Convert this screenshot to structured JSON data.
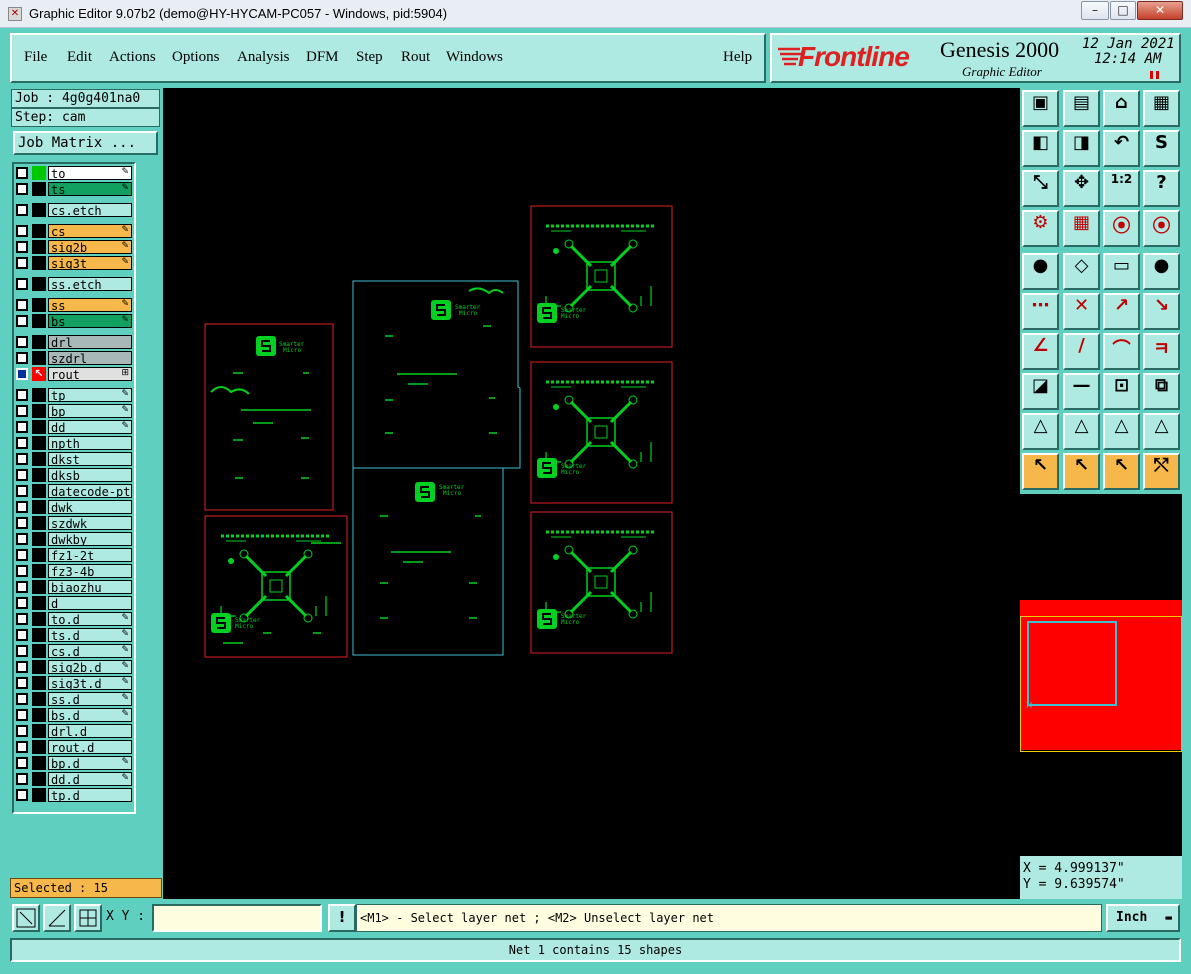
{
  "window": {
    "title": "Graphic Editor 9.07b2 (demo@HY-HYCAM-PC057 - Windows, pid:5904)",
    "minimize": "–",
    "maximize": "□",
    "close": "✕"
  },
  "menubar": {
    "items": [
      "File",
      "Edit",
      "Actions",
      "Options",
      "Analysis",
      "DFM",
      "Step",
      "Rout",
      "Windows"
    ],
    "help": "Help"
  },
  "brand": {
    "logo": "Frontline",
    "product": "Genesis 2000",
    "subtitle": "Graphic Editor",
    "date": "12 Jan 2021",
    "time": "12:14 AM"
  },
  "job": {
    "job_line": "Job : 4g0g401na0",
    "step_line": "Step: cam",
    "matrix_button": "Job Matrix ..."
  },
  "layers": [
    {
      "name": "to",
      "color": "#ffffff",
      "swatch": "#00c800",
      "edit": true
    },
    {
      "name": "ts",
      "color": "#12a060",
      "swatch": "#000000",
      "edit": true
    },
    {
      "name": "cs.etch",
      "color": "#aeeae2",
      "swatch": "#000000",
      "edit": false
    },
    {
      "name": "cs",
      "color": "#f6b84a",
      "swatch": "#000000",
      "edit": true
    },
    {
      "name": "sig2b",
      "color": "#f6b84a",
      "swatch": "#000000",
      "edit": true
    },
    {
      "name": "sig3t",
      "color": "#f6b84a",
      "swatch": "#000000",
      "edit": true
    },
    {
      "name": "ss.etch",
      "color": "#aeeae2",
      "swatch": "#000000",
      "edit": false
    },
    {
      "name": "ss",
      "color": "#f6b84a",
      "swatch": "#000000",
      "edit": true
    },
    {
      "name": "bs",
      "color": "#12a060",
      "swatch": "#000000",
      "edit": true
    },
    {
      "name": "drl",
      "color": "#a8b8b8",
      "swatch": "#000000",
      "edit": false
    },
    {
      "name": "szdrl",
      "color": "#a8b8b8",
      "swatch": "#000000",
      "edit": false
    },
    {
      "name": "rout",
      "color": "#e0e0e0",
      "swatch": "#ff0000",
      "edit": true,
      "active": true
    },
    {
      "name": "tp",
      "color": "#aeeae2",
      "swatch": "#000000",
      "edit": true
    },
    {
      "name": "bp",
      "color": "#aeeae2",
      "swatch": "#000000",
      "edit": true
    },
    {
      "name": "dd",
      "color": "#aeeae2",
      "swatch": "#000000",
      "edit": true
    },
    {
      "name": "npth",
      "color": "#aeeae2",
      "swatch": "#000000",
      "edit": false
    },
    {
      "name": "dkst",
      "color": "#aeeae2",
      "swatch": "#000000",
      "edit": false
    },
    {
      "name": "dksb",
      "color": "#aeeae2",
      "swatch": "#000000",
      "edit": false
    },
    {
      "name": "datecode-pte",
      "color": "#aeeae2",
      "swatch": "#000000",
      "edit": false
    },
    {
      "name": "dwk",
      "color": "#aeeae2",
      "swatch": "#000000",
      "edit": false
    },
    {
      "name": "szdwk",
      "color": "#aeeae2",
      "swatch": "#000000",
      "edit": false
    },
    {
      "name": "dwkby",
      "color": "#aeeae2",
      "swatch": "#000000",
      "edit": false
    },
    {
      "name": "fz1-2t",
      "color": "#aeeae2",
      "swatch": "#000000",
      "edit": false
    },
    {
      "name": "fz3-4b",
      "color": "#aeeae2",
      "swatch": "#000000",
      "edit": false
    },
    {
      "name": "biaozhu",
      "color": "#aeeae2",
      "swatch": "#000000",
      "edit": false
    },
    {
      "name": "d",
      "color": "#aeeae2",
      "swatch": "#000000",
      "edit": false
    },
    {
      "name": "to.d",
      "color": "#aeeae2",
      "swatch": "#000000",
      "edit": true
    },
    {
      "name": "ts.d",
      "color": "#aeeae2",
      "swatch": "#000000",
      "edit": true
    },
    {
      "name": "cs.d",
      "color": "#aeeae2",
      "swatch": "#000000",
      "edit": true
    },
    {
      "name": "sig2b.d",
      "color": "#aeeae2",
      "swatch": "#000000",
      "edit": true
    },
    {
      "name": "sig3t.d",
      "color": "#aeeae2",
      "swatch": "#000000",
      "edit": true
    },
    {
      "name": "ss.d",
      "color": "#aeeae2",
      "swatch": "#000000",
      "edit": true
    },
    {
      "name": "bs.d",
      "color": "#aeeae2",
      "swatch": "#000000",
      "edit": true
    },
    {
      "name": "drl.d",
      "color": "#aeeae2",
      "swatch": "#000000",
      "edit": false
    },
    {
      "name": "rout.d",
      "color": "#aeeae2",
      "swatch": "#000000",
      "edit": false
    },
    {
      "name": "bp.d",
      "color": "#aeeae2",
      "swatch": "#000000",
      "edit": true
    },
    {
      "name": "dd.d",
      "color": "#aeeae2",
      "swatch": "#000000",
      "edit": true
    },
    {
      "name": "tp.d",
      "color": "#aeeae2",
      "swatch": "#000000",
      "edit": false
    }
  ],
  "selected": "Selected : 15",
  "coords": {
    "x": "X = 4.999137\"",
    "y": "Y = 9.639574\""
  },
  "bottom": {
    "xy_label": "X Y :",
    "xy_value": "",
    "alert": "!",
    "message": "<M1> - Select layer net ; <M2> Unselect layer net",
    "units": "Inch",
    "status": "Net 1 contains 15 shapes"
  },
  "board": {
    "brand_text_1": "Smarter",
    "brand_text_2": "Micro"
  },
  "colors": {
    "frame": "#5fd0c0",
    "panel": "#aeeae2",
    "canvas": "#000000",
    "rout": "#ff2020",
    "profile": "#40c0d0",
    "copper": "#00d020"
  }
}
